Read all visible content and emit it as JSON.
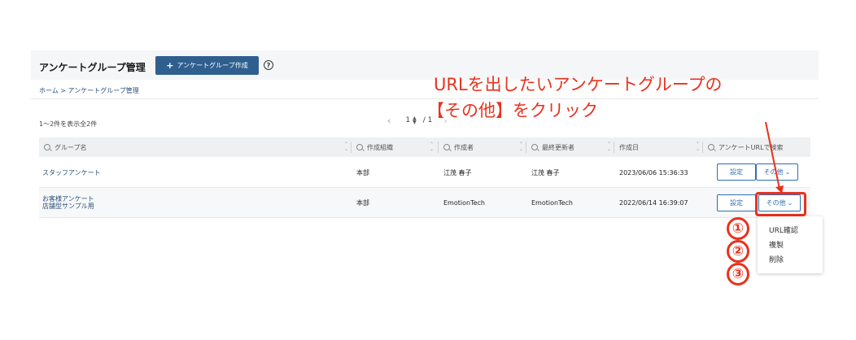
{
  "header": {
    "title": "アンケートグループ管理",
    "create_button": "アンケートグループ作成",
    "help_icon": "?"
  },
  "breadcrumb": "ホーム > アンケートグループ管理",
  "list_info": {
    "count_text": "1〜2件を表示全2件",
    "page_current": "1",
    "page_total": "/ 1"
  },
  "filters": [
    "グループ名",
    "作成組織",
    "作成者",
    "最終更新者",
    "作成日",
    "アンケートURLで検索"
  ],
  "rows": [
    {
      "name": "スタッフアンケート",
      "org": "本部",
      "creator": "江茂 春子",
      "updater": "江茂 春子",
      "created": "2023/06/06 15:36:33",
      "setting_label": "設定",
      "other_label": "その他"
    },
    {
      "name_line1": "お客様アンケート",
      "name_line2": "店舗型サンプル用",
      "org": "本部",
      "creator": "EmotionTech",
      "updater": "EmotionTech",
      "created": "2022/06/14 16:39:07",
      "setting_label": "設定",
      "other_label": "その他"
    }
  ],
  "dropdown_menu": {
    "items": [
      "URL確認",
      "複製",
      "削除"
    ]
  },
  "annotation": {
    "line1": "URLを出したいアンケートグループの",
    "line2": "【その他】をクリック",
    "numbers": [
      "①",
      "②",
      "③"
    ],
    "color": "#e8321e"
  },
  "colors": {
    "primary": "#2f5f8f",
    "accent_red": "#e8321e",
    "link": "#2a4f78"
  }
}
